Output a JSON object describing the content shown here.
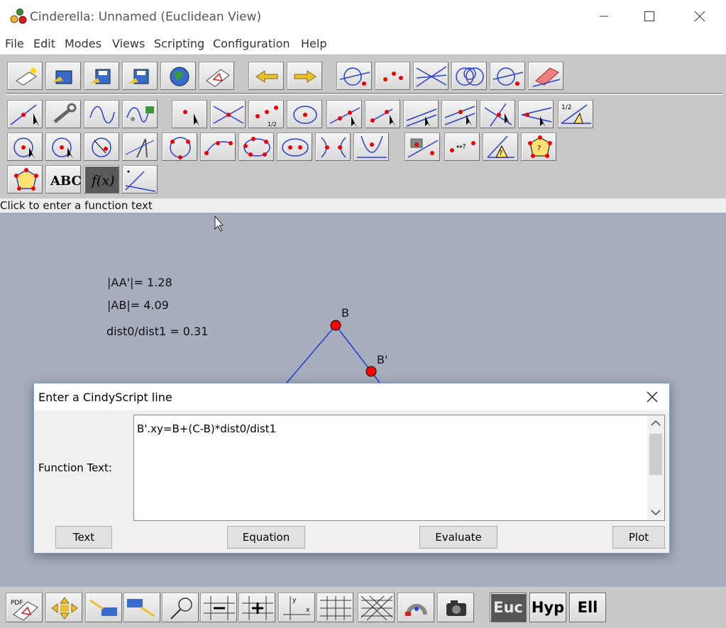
{
  "window": {
    "title": "Cinderella: Unnamed (Euclidean View)"
  },
  "menu": [
    "File",
    "Edit",
    "Modes",
    "Views",
    "Scripting",
    "Configuration",
    "Help"
  ],
  "toolbar": {
    "text_button_label": "ABC",
    "function_button_label": "f(x)"
  },
  "status": {
    "text": "Click to enter a function text"
  },
  "canvas": {
    "measurements": [
      "|AA'|= 1.28",
      "|AB|= 4.09",
      "dist0/dist1 = 0.31"
    ],
    "point_labels": [
      "B",
      "B'"
    ],
    "point_color": "#ff0000",
    "line_color": "#2a3fd4"
  },
  "dialog": {
    "title": "Enter a CindyScript line",
    "field_label": "Function Text:",
    "field_value": "B'.xy=B+(C-B)*dist0/dist1",
    "buttons": [
      "Text",
      "Equation",
      "Evaluate",
      "Plot"
    ]
  },
  "bottom_toolbar": {
    "geometry_modes": [
      "Euc",
      "Hyp",
      "Ell"
    ],
    "selected_mode": "Euc"
  }
}
